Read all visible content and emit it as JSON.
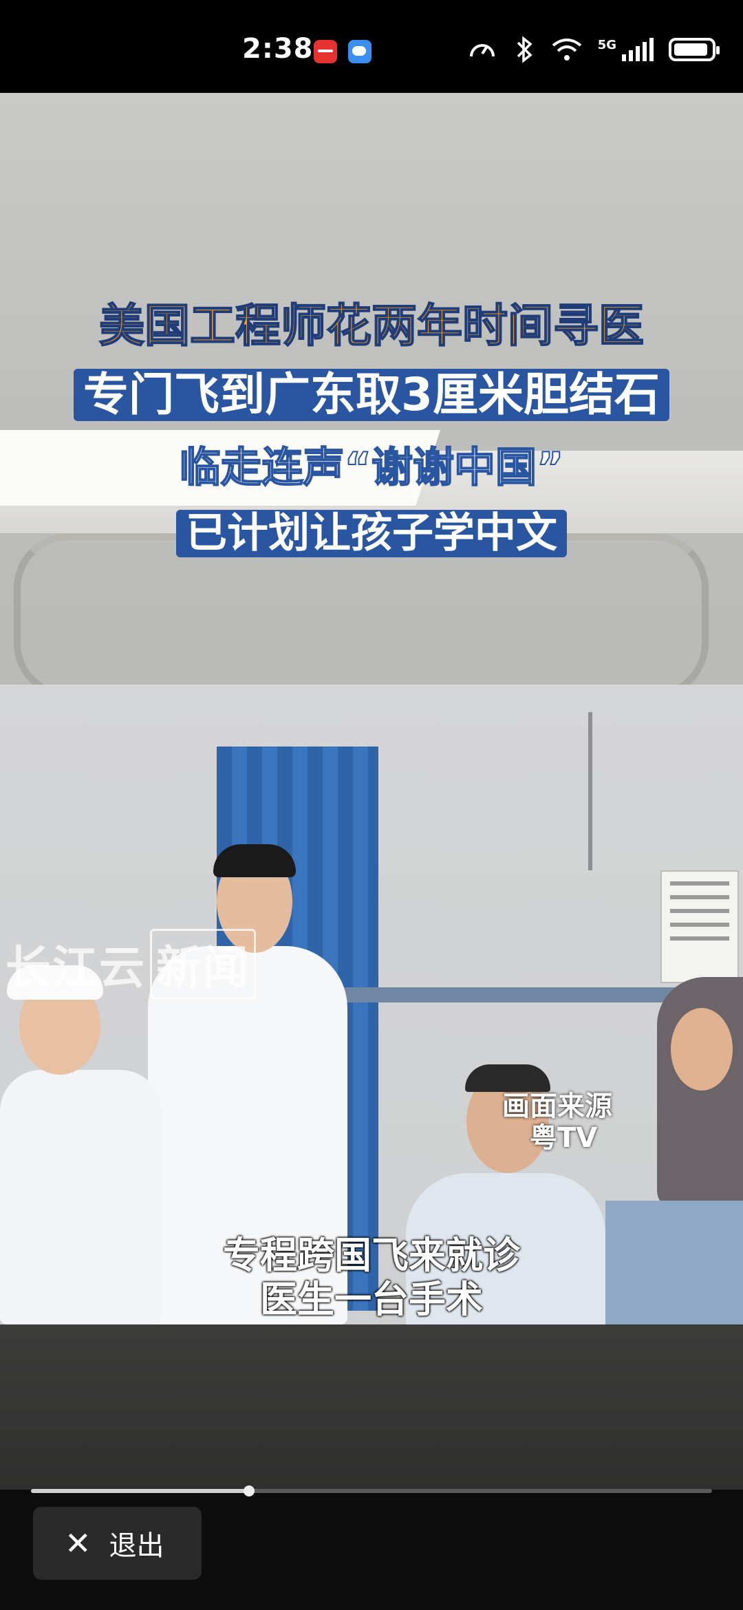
{
  "status_bar": {
    "time": "2:38",
    "network": "5G",
    "icons": [
      "app-notification-icon",
      "weather-icon",
      "data-speed-icon",
      "bluetooth-icon",
      "wifi-icon",
      "signal-icon",
      "battery-icon"
    ]
  },
  "video": {
    "headline": {
      "line1": "美国工程师花两年时间寻医",
      "line2": "专门飞到广东取3厘米胆结石",
      "line3": "临走连声“谢谢中国”",
      "line4": "已计划让孩子学中文"
    },
    "watermark": {
      "part1": "长江云",
      "part2": "新闻"
    },
    "source": {
      "line1": "画面来源",
      "line2": "粤TV"
    },
    "subtitle": {
      "line1": "专程跨国飞来就诊",
      "line2": "医生一台手术"
    },
    "progress": 0.32
  },
  "controls": {
    "exit_label": "退出"
  },
  "colors": {
    "headline_orange": "#ffa21a",
    "headline_blue": "#2a55a0"
  }
}
